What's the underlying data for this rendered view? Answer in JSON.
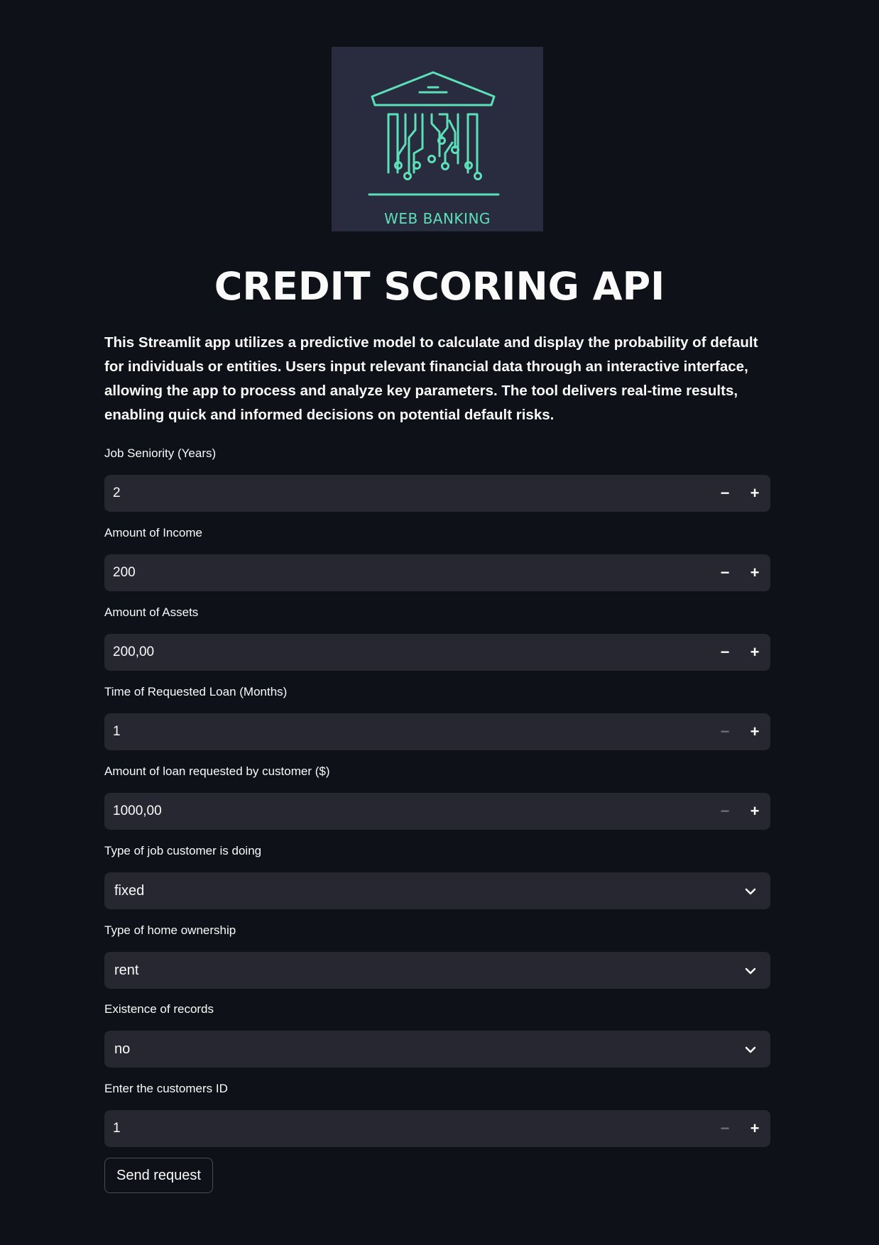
{
  "logo": {
    "text": "WEB BANKING",
    "background": "#292b3f",
    "accent": "#5de0b9"
  },
  "title": "CREDIT SCORING API",
  "description": "This Streamlit app utilizes a predictive model to calculate and display the probability of default for individuals or entities. Users input relevant financial data through an interactive interface, allowing the app to process and analyze key parameters. The tool delivers real-time results, enabling quick and informed decisions on potential default risks.",
  "fields": {
    "job_seniority": {
      "label": "Job Seniority (Years)",
      "value": "2"
    },
    "income": {
      "label": "Amount of Income",
      "value": "200"
    },
    "assets": {
      "label": "Amount of Assets",
      "value": "200,00"
    },
    "loan_time": {
      "label": "Time of Requested Loan (Months)",
      "value": "1"
    },
    "loan_amount": {
      "label": "Amount of loan requested by customer ($)",
      "value": "1000,00"
    },
    "job_type": {
      "label": "Type of job customer is doing",
      "value": "fixed"
    },
    "home_ownership": {
      "label": "Type of home ownership",
      "value": "rent"
    },
    "records": {
      "label": "Existence of records",
      "value": "no"
    },
    "customer_id": {
      "label": "Enter the customers ID",
      "value": "1"
    }
  },
  "stepper": {
    "minus": "−",
    "plus": "+"
  },
  "send_button": "Send request",
  "colors": {
    "background": "#0e1117",
    "input_background": "#262730",
    "text": "#fafafa"
  }
}
